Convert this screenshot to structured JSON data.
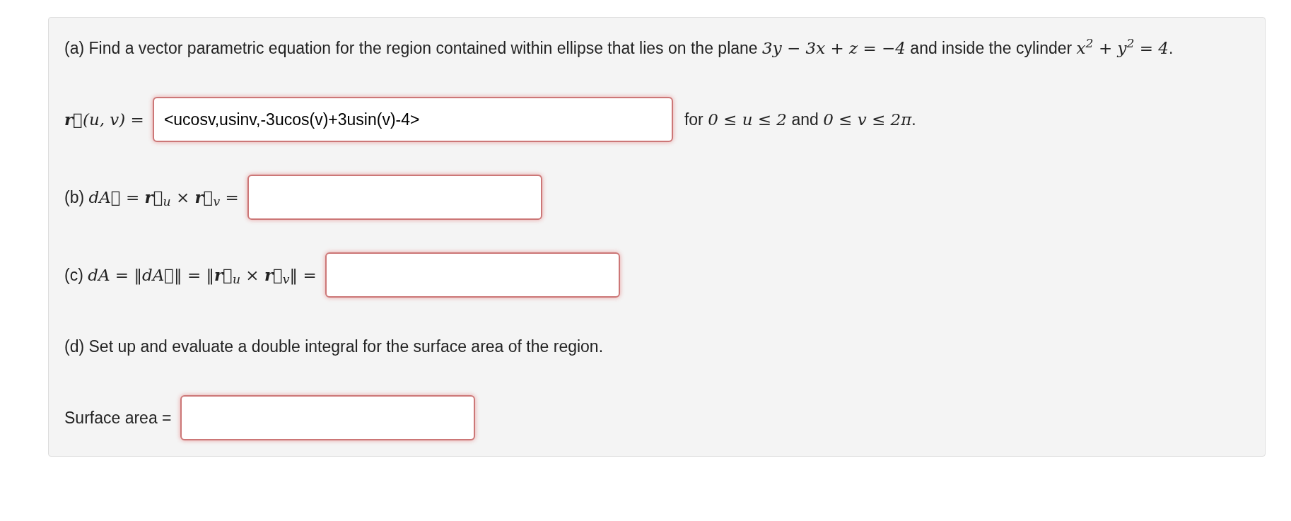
{
  "items": [
    {
      "kind": "paragraph",
      "segments": [
        {
          "kind": "text",
          "text": "(a) Find a vector parametric equation for the region contained within ellipse that lies on the plane "
        },
        {
          "kind": "math",
          "text": "3y − 3x + z = −4"
        },
        {
          "kind": "text",
          "text": " and inside the cylinder "
        },
        {
          "kind": "math",
          "text": "x$^{2}$ + y$^{2}$ = 4"
        },
        {
          "kind": "text",
          "text": "."
        }
      ]
    },
    {
      "kind": "answer",
      "label": [
        {
          "kind": "math",
          "text": "**r⃗**(u, v) ="
        }
      ],
      "value": "<ucosv,usinv,-3ucos(v)+3usin(v)-4>",
      "after": [
        {
          "kind": "text",
          "text": "for "
        },
        {
          "kind": "math",
          "text": "0 ≤ u ≤ 2"
        },
        {
          "kind": "text",
          "text": " and "
        },
        {
          "kind": "math",
          "text": "0 ≤ v ≤ 2π"
        },
        {
          "kind": "text",
          "text": "."
        }
      ]
    },
    {
      "kind": "answer",
      "label": [
        {
          "kind": "text",
          "text": "(b) "
        },
        {
          "kind": "math",
          "text": "dA⃗ = **r⃗**$_{u}$ × **r⃗**$_{v}$ ="
        }
      ]
    },
    {
      "kind": "answer",
      "label": [
        {
          "kind": "text",
          "text": "(c) "
        },
        {
          "kind": "math",
          "text": "dA = ‖dA⃗‖ = ‖**r⃗**$_{u}$ × **r⃗**$_{v}$‖ ="
        }
      ]
    },
    {
      "kind": "paragraph",
      "segments": [
        {
          "kind": "text",
          "text": "(d) Set up and evaluate a double integral for the surface area of the region."
        }
      ]
    },
    {
      "kind": "answer",
      "label": [
        {
          "kind": "text",
          "text": "Surface area ="
        }
      ]
    }
  ]
}
